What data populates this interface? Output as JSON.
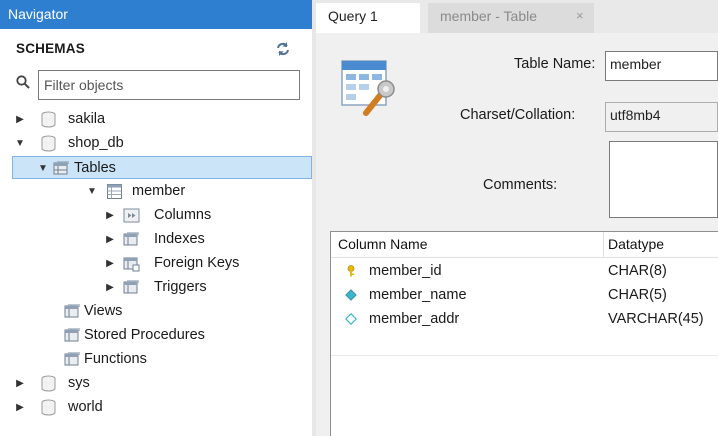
{
  "navigator": {
    "title": "Navigator",
    "schemas_label": "SCHEMAS",
    "filter_placeholder": "Filter objects",
    "tree": {
      "sakila": "sakila",
      "shop_db": "shop_db",
      "tables": "Tables",
      "member": "member",
      "columns": "Columns",
      "indexes": "Indexes",
      "foreign_keys": "Foreign Keys",
      "triggers": "Triggers",
      "views": "Views",
      "stored_procedures": "Stored Procedures",
      "functions": "Functions",
      "sys": "sys",
      "world": "world"
    },
    "selected": "Tables"
  },
  "tabs": [
    {
      "label": "Query 1",
      "active": true
    },
    {
      "label": "member - Table",
      "active": false,
      "close": "×"
    }
  ],
  "editor": {
    "table_name_label": "Table Name:",
    "table_name_value": "member",
    "charset_label": "Charset/Collation:",
    "charset_value": "utf8mb4",
    "comments_label": "Comments:",
    "comments_value": ""
  },
  "columns_grid": {
    "headers": {
      "name": "Column Name",
      "datatype": "Datatype"
    },
    "rows": [
      {
        "name": "member_id",
        "datatype": "CHAR(8)",
        "icon": "primary-key-icon"
      },
      {
        "name": "member_name",
        "datatype": "CHAR(5)",
        "icon": "not-null-column-icon"
      },
      {
        "name": "member_addr",
        "datatype": "VARCHAR(45)",
        "icon": "nullable-column-icon"
      }
    ]
  },
  "colors": {
    "nav_header": "#2f7fd1",
    "selection": "#cce4f7",
    "key_icon": "#e8b90c",
    "column_icon": "#3bb5c9"
  }
}
